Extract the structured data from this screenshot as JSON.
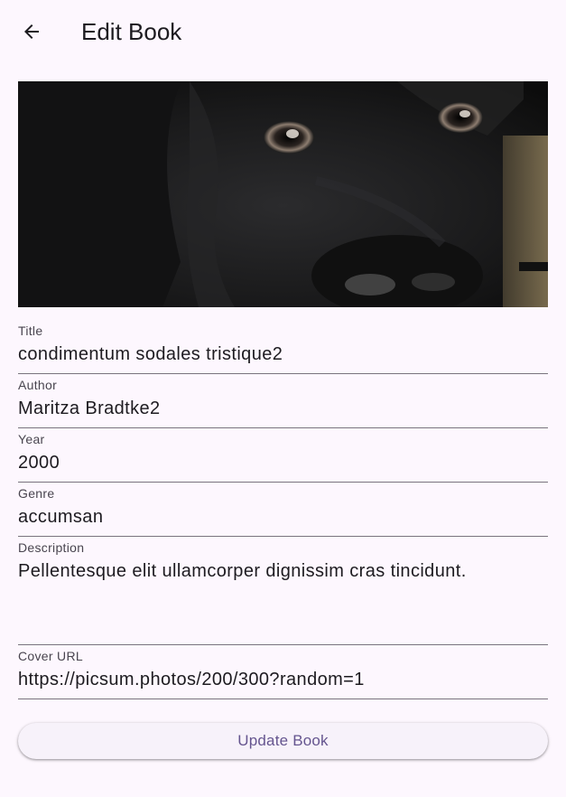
{
  "app_bar": {
    "title": "Edit Book",
    "back_icon": "arrow-back-icon"
  },
  "cover_image": {
    "alt": "black dog close-up"
  },
  "form": {
    "title": {
      "label": "Title",
      "value": "condimentum sodales tristique2"
    },
    "author": {
      "label": "Author",
      "value": "Maritza Bradtke2"
    },
    "year": {
      "label": "Year",
      "value": "2000"
    },
    "genre": {
      "label": "Genre",
      "value": "accumsan"
    },
    "description": {
      "label": "Description",
      "value": "Pellentesque elit ullamcorper dignissim cras tincidunt."
    },
    "cover_url": {
      "label": "Cover URL",
      "value": "https://picsum.photos/200/300?random=1"
    }
  },
  "actions": {
    "update_label": "Update Book"
  },
  "colors": {
    "background": "#fdf7fe",
    "accent": "#65558f",
    "underline": "#79747e"
  }
}
